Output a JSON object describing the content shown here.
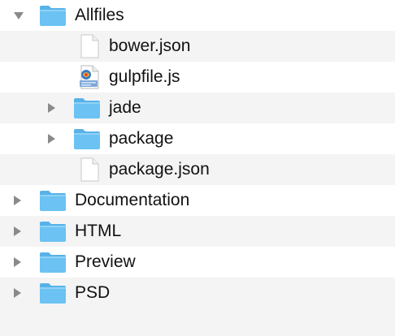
{
  "file_tree": {
    "items": [
      {
        "label": "Allfiles",
        "kind": "folder",
        "expanded": true,
        "icon": "folder-icon"
      },
      {
        "label": "bower.json",
        "kind": "file",
        "icon": "document-icon"
      },
      {
        "label": "gulpfile.js",
        "kind": "file",
        "icon": "javascript-file-icon"
      },
      {
        "label": "jade",
        "kind": "folder",
        "expanded": false,
        "icon": "folder-icon"
      },
      {
        "label": "package",
        "kind": "folder",
        "expanded": false,
        "icon": "folder-icon"
      },
      {
        "label": "package.json",
        "kind": "file",
        "icon": "document-icon"
      },
      {
        "label": "Documentation",
        "kind": "folder",
        "expanded": false,
        "icon": "folder-icon"
      },
      {
        "label": "HTML",
        "kind": "folder",
        "expanded": false,
        "icon": "folder-icon"
      },
      {
        "label": "Preview",
        "kind": "folder",
        "expanded": false,
        "icon": "folder-icon"
      },
      {
        "label": "PSD",
        "kind": "folder",
        "expanded": false,
        "icon": "folder-icon"
      }
    ]
  },
  "colors": {
    "row_stripe": "#f4f4f5",
    "folder_body": "#6cc2f2",
    "folder_tab": "#58b2e8",
    "disclosure_arrow": "#8a8a8a"
  }
}
